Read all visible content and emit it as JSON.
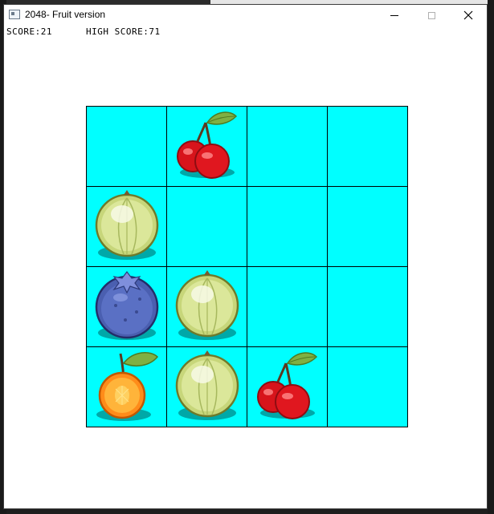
{
  "window": {
    "title": "2048- Fruit version",
    "icon": "app-window-icon",
    "buttons": [
      "minimize",
      "maximize",
      "close"
    ]
  },
  "scores": {
    "score_text": "SCORE:21",
    "high_score_text": "HIGH SCORE:71"
  },
  "board": {
    "rows": 4,
    "cols": 4,
    "cell_color": "#00ffff",
    "grid_color": "#000000",
    "tiles": [
      [
        "empty",
        "cherry",
        "empty",
        "empty"
      ],
      [
        "gooseberry",
        "empty",
        "empty",
        "empty"
      ],
      [
        "blueberry",
        "gooseberry",
        "empty",
        "empty"
      ],
      [
        "orange",
        "gooseberry",
        "cherry",
        "empty"
      ]
    ]
  }
}
